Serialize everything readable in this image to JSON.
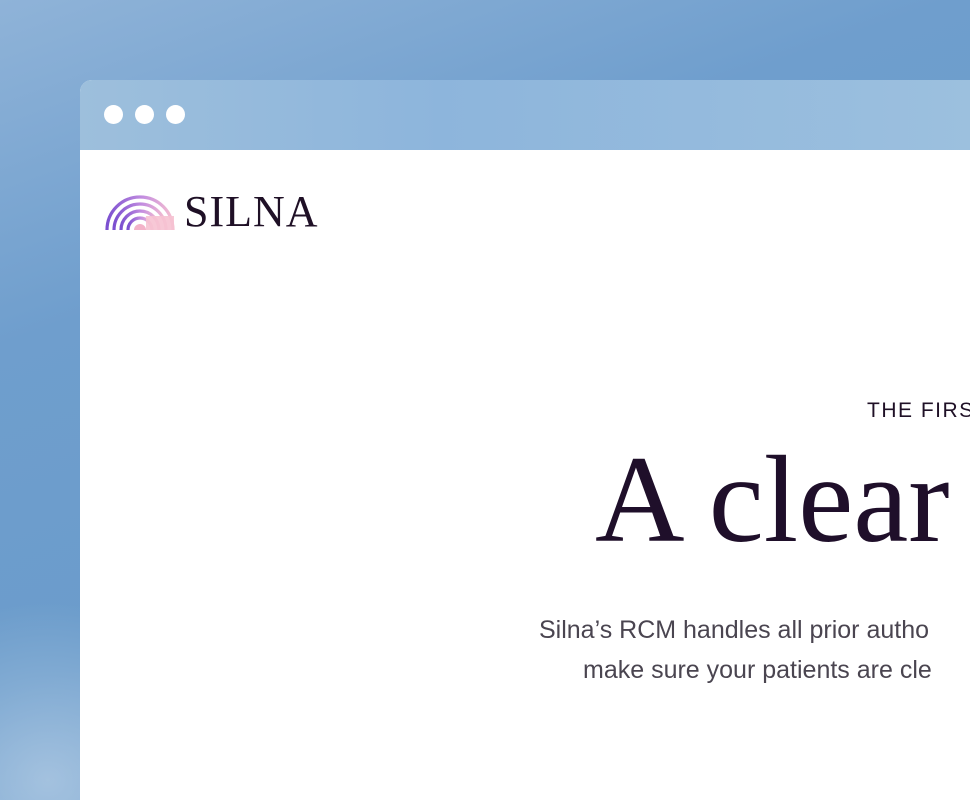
{
  "brand": {
    "name": "SILNA"
  },
  "hero": {
    "eyebrow": "THE FIRS",
    "headline": "A clear",
    "sub_line_1": "Silna’s RCM handles all prior autho",
    "sub_line_2": "make sure your patients are cle"
  },
  "colors": {
    "background": "#6f9ecd",
    "titlebar": "#8db5dc",
    "text_dark": "#1f0f2a",
    "text_muted": "#4a4550",
    "logo_gradient": [
      "#7b4fd0",
      "#f3b3c9"
    ]
  }
}
